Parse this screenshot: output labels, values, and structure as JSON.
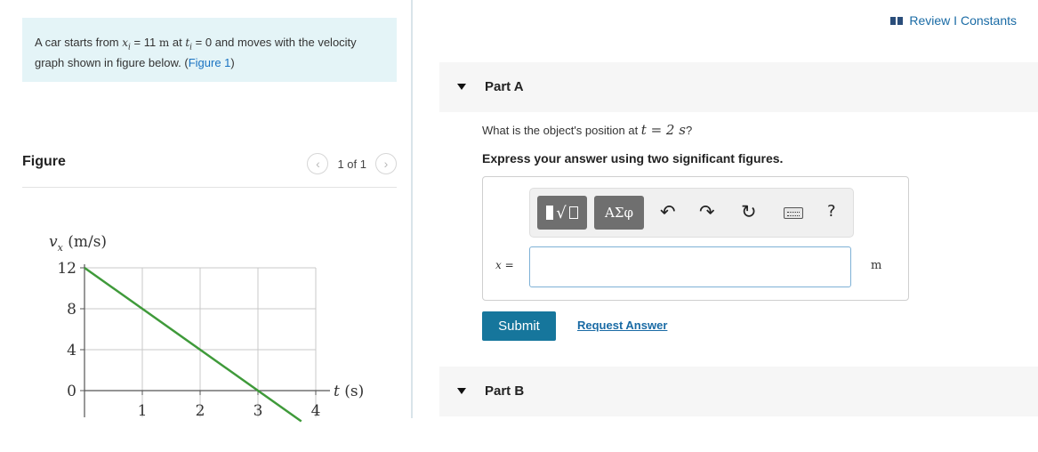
{
  "problem": {
    "text_before_x": "A car starts from ",
    "x_symbol": "x",
    "x_sub": "i",
    "eq1": " = 11 ",
    "unit_m": "m",
    "text_at": " at ",
    "t_symbol": "t",
    "t_sub": "i",
    "text_after": " = 0 and moves with the velocity graph shown in figure below. (",
    "figure_link": "Figure 1",
    "close_paren": ")"
  },
  "figure": {
    "title": "Figure",
    "pager_text": "1 of 1",
    "prev_icon": "chevron-left-icon",
    "next_icon": "chevron-right-icon"
  },
  "chart_data": {
    "type": "line",
    "ylabel_symbol": "v",
    "ylabel_sub": "x",
    "ylabel_unit": " (m/s)",
    "xlabel": "t (s)",
    "x_ticks": [
      "1",
      "2",
      "3",
      "4"
    ],
    "y_ticks": [
      "0",
      "4",
      "8",
      "12"
    ],
    "xlim": [
      0,
      4
    ],
    "ylim": [
      0,
      12
    ],
    "grid": true,
    "series": [
      {
        "x": [
          0,
          3,
          3.75
        ],
        "y": [
          12,
          0,
          -3
        ],
        "color": "#3f9a3a"
      }
    ]
  },
  "header": {
    "review_label": "Review I Constants",
    "review_icon": "book-icon"
  },
  "part_a": {
    "label": "Part A",
    "question_prefix": "What is the object's position at ",
    "question_math": "t = 2 s",
    "question_suffix": "?",
    "instruction": "Express your answer using two significant figures.",
    "var_label": "x",
    "var_eq": " =",
    "input_value": "",
    "unit": "m",
    "toolbar": {
      "templates_icon": "templates-icon",
      "symbols_label": "ΑΣφ",
      "undo_icon": "undo-icon",
      "redo_icon": "redo-icon",
      "reset_icon": "reset-icon",
      "keyboard_icon": "keyboard-icon",
      "help_label": "?"
    },
    "submit_label": "Submit",
    "request_label": "Request Answer"
  },
  "part_b": {
    "label": "Part B"
  }
}
